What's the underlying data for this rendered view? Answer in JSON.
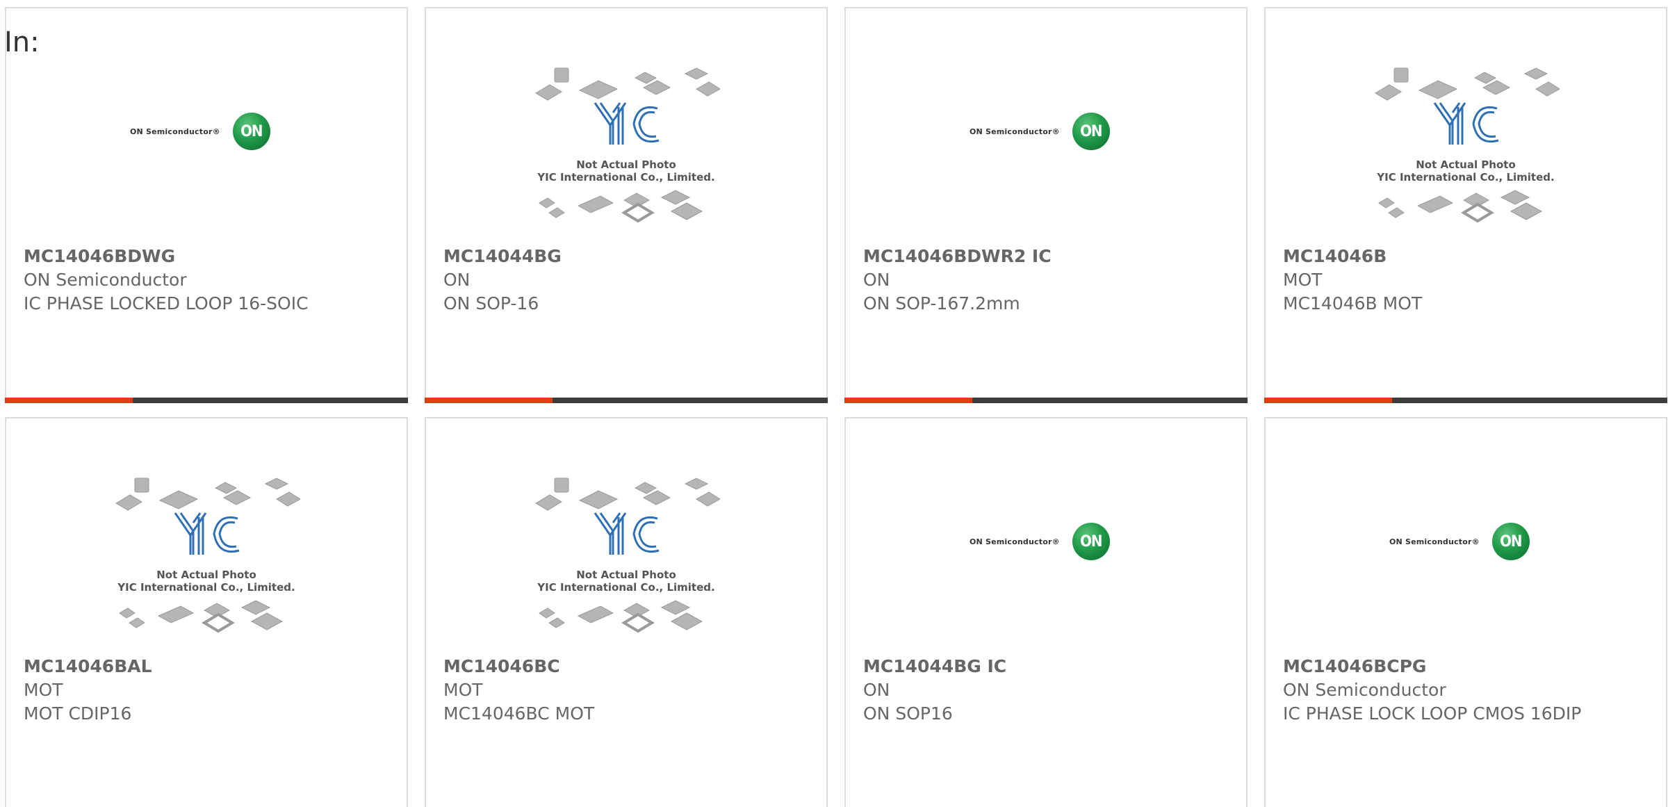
{
  "header": {
    "in_label": "In:"
  },
  "brand": {
    "accent_color": "#e23c12",
    "bar_color": "#3c3c3c",
    "on_green": "#1f9a48"
  },
  "logos": {
    "on_semi_text": "ON Semiconductor®",
    "on_circle_text": "ON",
    "yic_line1": "Not Actual Photo",
    "yic_line2": "YIC International Co., Limited."
  },
  "products": [
    {
      "part": "MC14046BDWG",
      "maker": "ON Semiconductor",
      "desc": "IC PHASE LOCKED LOOP 16-SOIC",
      "image": "on-semiconductor-logo"
    },
    {
      "part": "MC14044BG",
      "maker": "ON",
      "desc": "ON SOP-16",
      "image": "yic-placeholder"
    },
    {
      "part": "MC14046BDWR2 IC",
      "maker": "ON",
      "desc": "ON SOP-167.2mm",
      "image": "on-semiconductor-logo"
    },
    {
      "part": "MC14046B",
      "maker": "MOT",
      "desc": "MC14046B MOT",
      "image": "yic-placeholder"
    },
    {
      "part": "MC14046BAL",
      "maker": "MOT",
      "desc": "MOT CDIP16",
      "image": "yic-placeholder"
    },
    {
      "part": "MC14046BC",
      "maker": "MOT",
      "desc": "MC14046BC MOT",
      "image": "yic-placeholder"
    },
    {
      "part": "MC14044BG IC",
      "maker": "ON",
      "desc": "ON SOP16",
      "image": "on-semiconductor-logo"
    },
    {
      "part": "MC14046BCPG",
      "maker": "ON Semiconductor",
      "desc": "IC PHASE LOCK LOOP CMOS 16DIP",
      "image": "on-semiconductor-logo"
    }
  ]
}
